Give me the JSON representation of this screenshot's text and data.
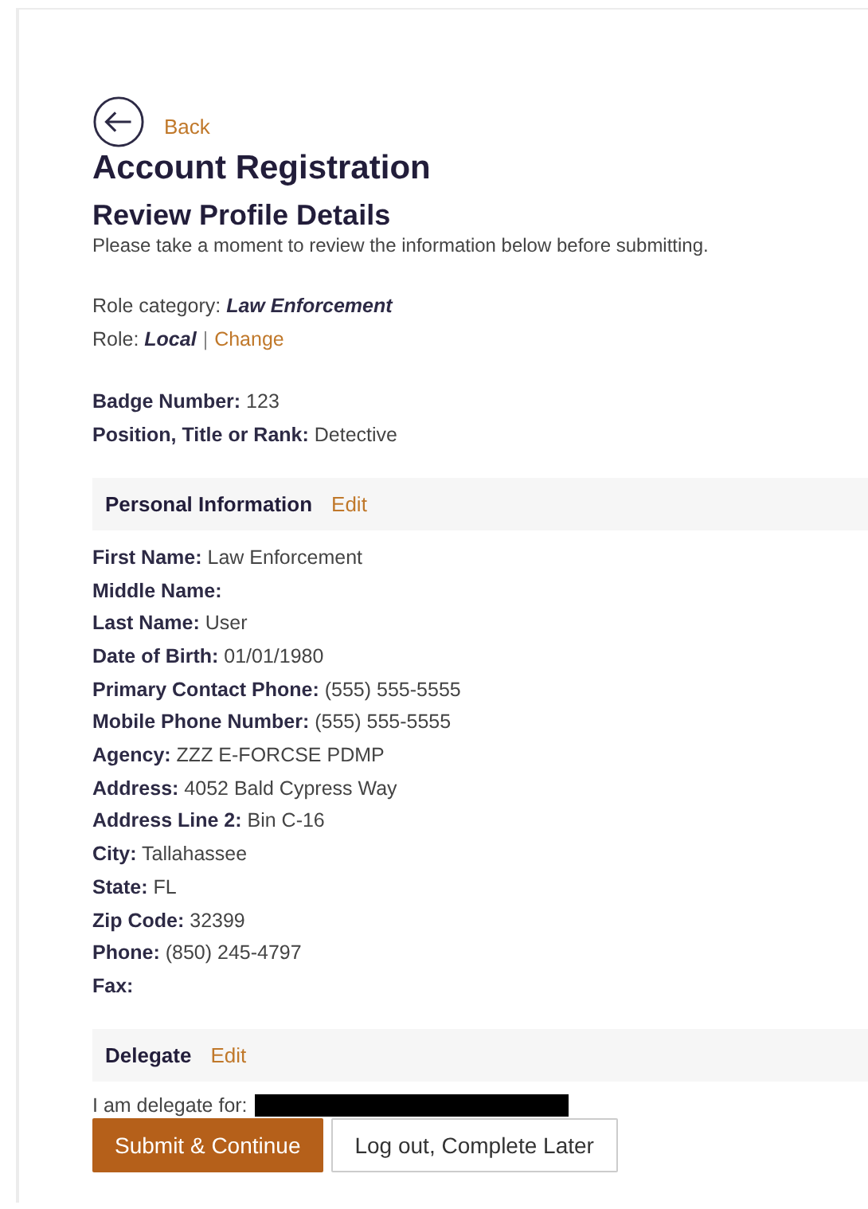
{
  "back": {
    "label": "Back"
  },
  "title": "Account Registration",
  "subtitle": "Review Profile Details",
  "description": "Please take a moment to review the information below before submitting.",
  "role_category": {
    "label": "Role category:",
    "value": "Law Enforcement"
  },
  "role": {
    "label": "Role:",
    "value": "Local",
    "separator": "|",
    "link": "Change"
  },
  "badge_fields": [
    {
      "label": "Badge Number:",
      "value": "123"
    },
    {
      "label": "Position, Title or Rank:",
      "value": "Detective"
    }
  ],
  "sections": [
    {
      "title": "Personal Information",
      "action": "Edit",
      "kind": "fields",
      "fields": [
        {
          "label": "First Name:",
          "value": "Law Enforcement"
        },
        {
          "label": "Middle Name:"
        },
        {
          "label": "Last Name:",
          "value": "User"
        },
        {
          "label": "Date of Birth:",
          "value": "01/01/1980"
        },
        {
          "label": "Primary Contact Phone:",
          "value": "(555) 555-5555"
        },
        {
          "label": "Mobile Phone Number:",
          "value": "(555) 555-5555"
        },
        {
          "label": "Agency:",
          "value": "ZZZ E-FORCSE PDMP"
        },
        {
          "label": "Address:",
          "value": "4052 Bald Cypress Way"
        },
        {
          "label": "Address Line 2:",
          "value": "Bin C-16"
        },
        {
          "label": "City:",
          "value": "Tallahassee"
        },
        {
          "label": "State:",
          "value": "FL"
        },
        {
          "label": "Zip Code:",
          "value": "32399"
        },
        {
          "label": "Phone:",
          "value": "(850) 245-4797"
        },
        {
          "label": "Fax:"
        }
      ]
    },
    {
      "title": "Delegate",
      "action": "Edit",
      "kind": "delegate",
      "text": "I am delegate for:",
      "redacted": true
    }
  ],
  "buttons": [
    {
      "label": "Submit & Continue",
      "kind": "primary"
    },
    {
      "label": "Log out, Complete Later",
      "kind": "secondary"
    }
  ]
}
